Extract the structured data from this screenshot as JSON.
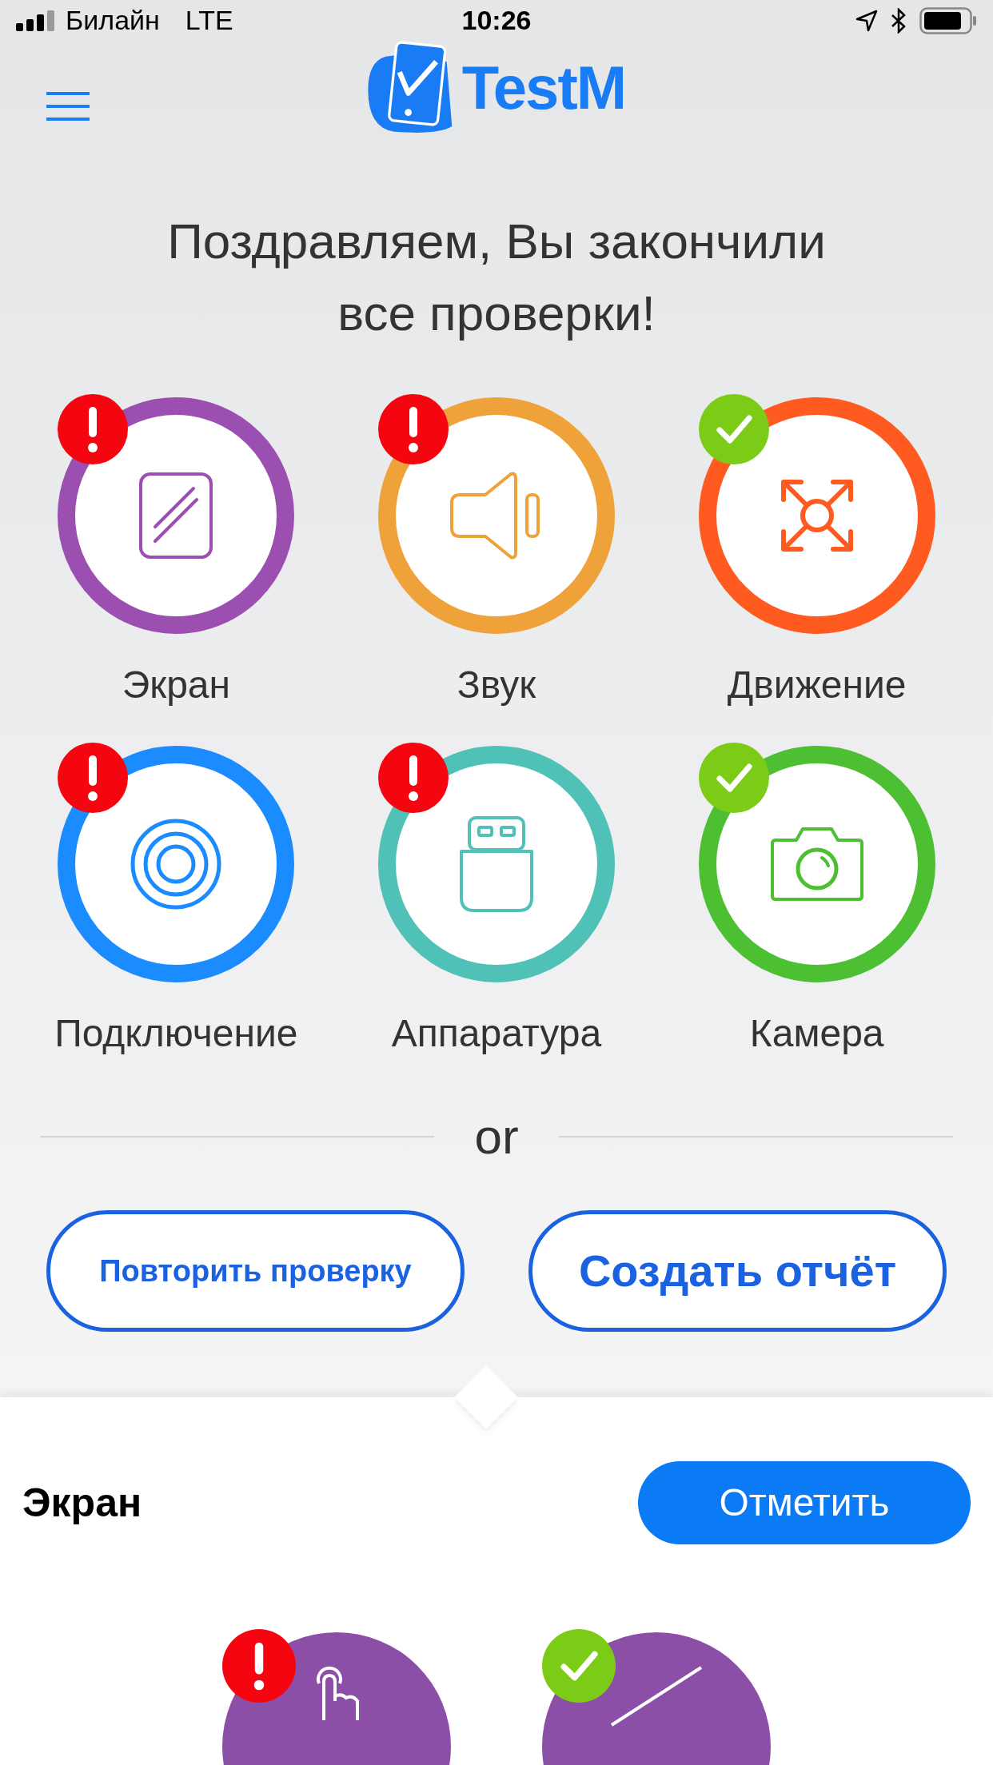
{
  "status_bar": {
    "carrier": "Билайн",
    "network": "LTE",
    "time": "10:26"
  },
  "app": {
    "logo": "TestM"
  },
  "title": "Поздравляем, Вы закончили все проверки!",
  "checks": [
    {
      "label": "Экран",
      "kind": "screen",
      "color": "#9b4fb0",
      "passed": false
    },
    {
      "label": "Звук",
      "kind": "sound",
      "color": "#f0a23a",
      "passed": false
    },
    {
      "label": "Движение",
      "kind": "motion",
      "color": "#ff5a1f",
      "passed": true
    },
    {
      "label": "Подключение",
      "kind": "connection",
      "color": "#1a8cff",
      "passed": false
    },
    {
      "label": "Аппаратура",
      "kind": "hardware",
      "color": "#4fc1b6",
      "passed": false
    },
    {
      "label": "Камера",
      "kind": "camera",
      "color": "#4cbf33",
      "passed": true
    }
  ],
  "separator": "or",
  "buttons": [
    {
      "label": "Повторить проверку"
    },
    {
      "label": "Создать отчёт"
    }
  ],
  "detail": {
    "title": "Экран",
    "action": "Отметить",
    "tests": [
      {
        "kind": "touch",
        "passed": false
      },
      {
        "kind": "line",
        "passed": true
      }
    ]
  }
}
